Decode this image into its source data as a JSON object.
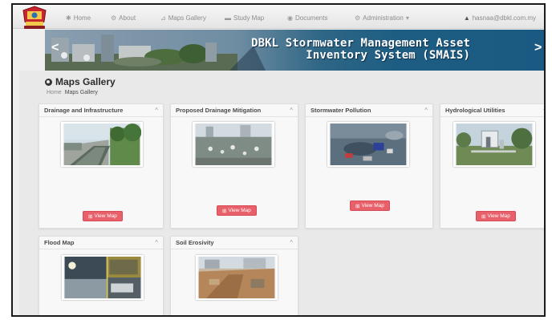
{
  "nav": {
    "home": "Home",
    "about": "About",
    "maps_gallery": "Maps Gallery",
    "study_map": "Study Map",
    "documents": "Documents",
    "administration": "Administration",
    "user": "hasnaa@dbkl.com.my"
  },
  "banner": {
    "title": "DBKL Stormwater Management Asset Inventory System (SMAIS)"
  },
  "page": {
    "title": "Maps Gallery",
    "breadcrumb_home": "Home",
    "breadcrumb_current": "Maps Gallery"
  },
  "cards": [
    {
      "title": "Drainage and Infrastructure",
      "button": "View Map"
    },
    {
      "title": "Proposed Drainage Mitigation",
      "button": "View Map"
    },
    {
      "title": "Stormwater Pollution",
      "button": "View Map"
    },
    {
      "title": "Hydrological Utilities",
      "button": "View Map"
    },
    {
      "title": "Flood Map"
    },
    {
      "title": "Soil Erosivity"
    }
  ],
  "colors": {
    "button": "#e8606a",
    "banner_blue": "#1e5d83"
  }
}
